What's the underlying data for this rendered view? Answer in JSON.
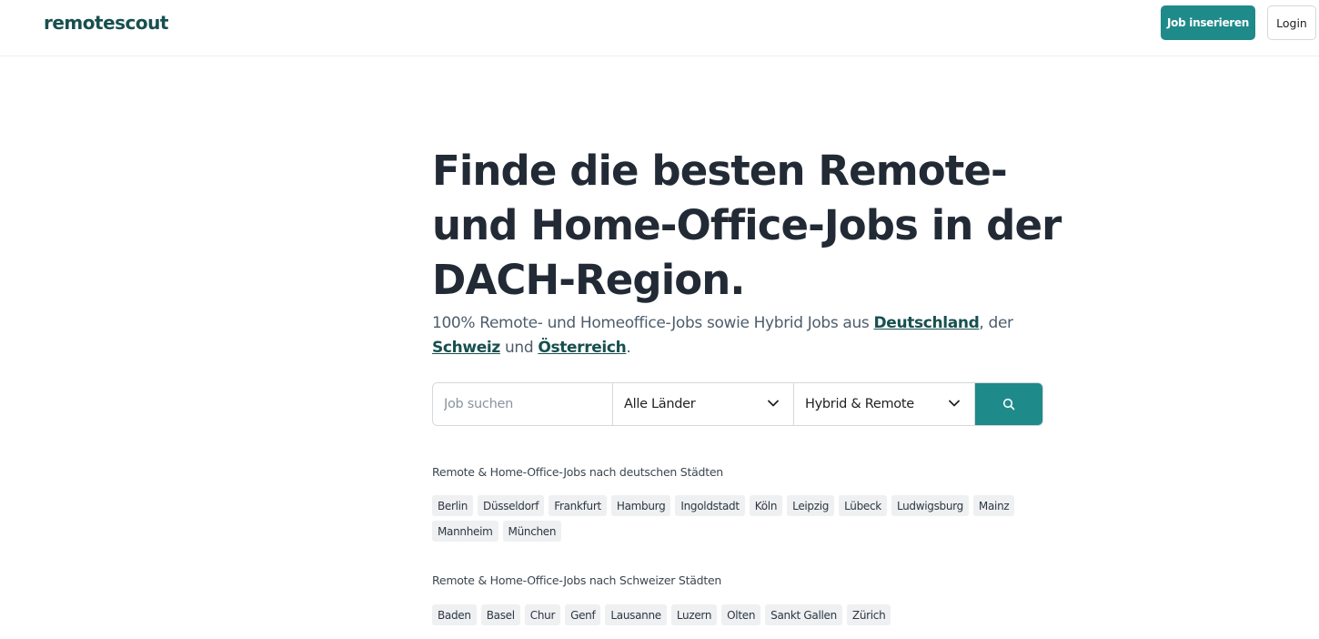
{
  "header": {
    "logo": "remotescout",
    "post_job_label": "Job inserieren",
    "login_label": "Login"
  },
  "hero": {
    "title": "Finde die besten Remote- und Home-Office-Jobs in der DACH-Region.",
    "sub_prefix": "100% Remote- und Homeoffice-Jobs sowie Hybrid Jobs aus ",
    "link_de": "Deutschland",
    "sub_mid1": ", der ",
    "link_ch": "Schweiz",
    "sub_mid2": " und ",
    "link_at": "Österreich",
    "sub_end": "."
  },
  "search": {
    "placeholder": "Job suchen",
    "country_value": "Alle Länder",
    "mode_value": "Hybrid & Remote",
    "button_icon": "search-icon"
  },
  "cities_de": {
    "label": "Remote & Home-Office-Jobs nach deutschen Städten",
    "items": [
      "Berlin",
      "Düsseldorf",
      "Frankfurt",
      "Hamburg",
      "Ingoldstadt",
      "Köln",
      "Leipzig",
      "Lübeck",
      "Ludwigsburg",
      "Mainz",
      "Mannheim",
      "München"
    ]
  },
  "cities_ch": {
    "label": "Remote & Home-Office-Jobs nach Schweizer Städten",
    "items": [
      "Baden",
      "Basel",
      "Chur",
      "Genf",
      "Lausanne",
      "Luzern",
      "Olten",
      "Sankt Gallen",
      "Zürich"
    ]
  },
  "colors": {
    "brand_dark": "#17504f",
    "brand_accent": "#1f8a8a"
  }
}
